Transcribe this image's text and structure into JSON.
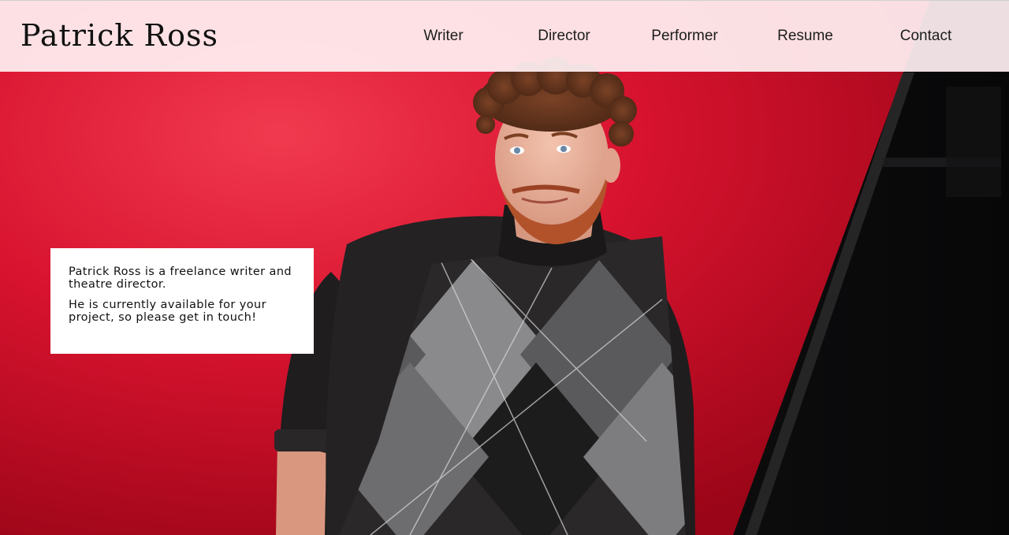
{
  "site": {
    "title": "Patrick Ross"
  },
  "nav": {
    "items": [
      {
        "label": "Writer"
      },
      {
        "label": "Director"
      },
      {
        "label": "Performer"
      },
      {
        "label": "Resume"
      },
      {
        "label": "Contact"
      }
    ]
  },
  "intro": {
    "paragraph_1": "Patrick Ross is a freelance writer and theatre director.",
    "paragraph_2": "He is currently available for your project, so please get in touch!"
  },
  "hero": {
    "image": "portrait-photo",
    "backdrop_color": "#d3122d",
    "shadow_color": "#0b0b0c"
  }
}
